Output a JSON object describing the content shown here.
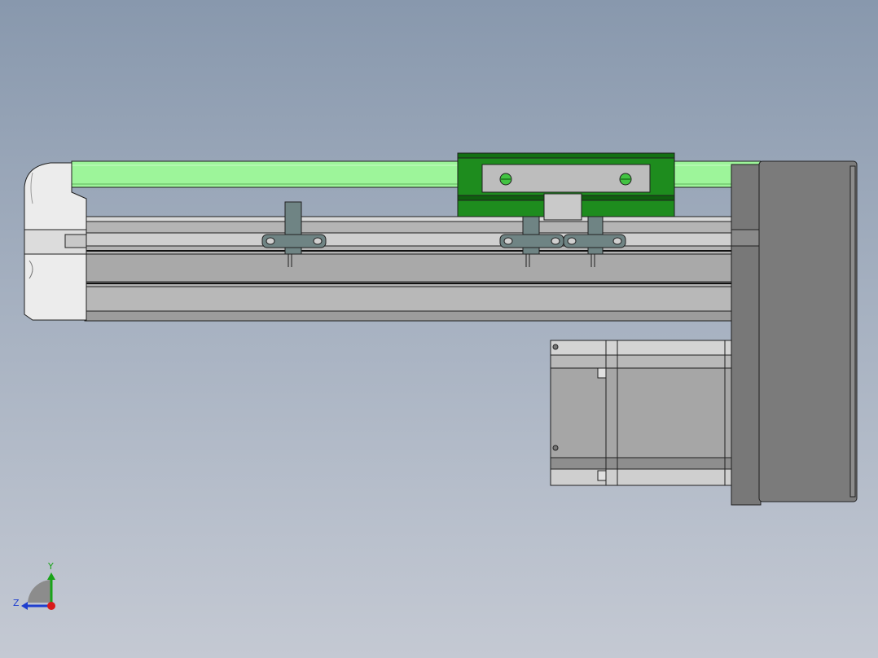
{
  "viewport": {
    "model": "linear-actuator-module"
  },
  "triad": {
    "y_label": "Y",
    "z_label": "Z",
    "y_color": "#19a319",
    "z_color": "#1f3fcf",
    "x_color": "#d81a1a"
  },
  "colors": {
    "belt_cover": "#9df59a",
    "carriage": "#1e8c1e",
    "body": "#b4b4b4",
    "motor": "#a6a6a6",
    "end_housing": "#787878",
    "end_cap": "#e9e9e9"
  }
}
